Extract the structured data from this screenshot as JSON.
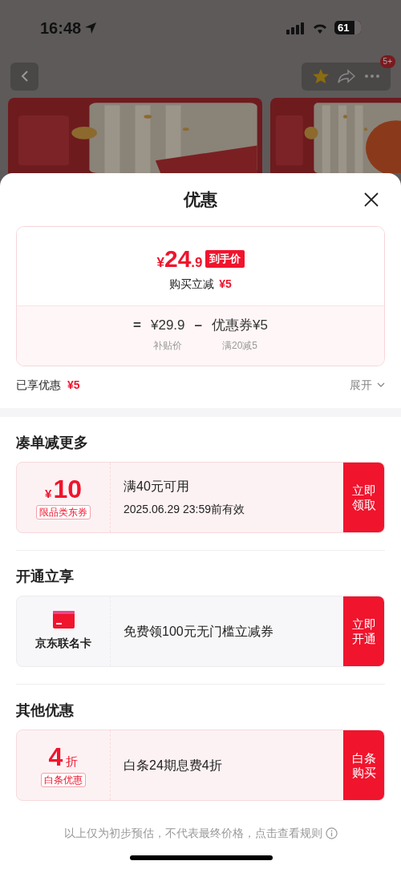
{
  "status_bar": {
    "time": "16:48",
    "battery": "61"
  },
  "nav": {
    "badge": "5+"
  },
  "sheet": {
    "title": "优惠"
  },
  "price_card": {
    "currency": "¥",
    "integer": "24",
    "decimal": ".9",
    "tag": "到手价",
    "instant_label": "购买立减",
    "instant_amount": "¥5",
    "equals": "=",
    "base": "¥29.9",
    "base_label": "补贴价",
    "minus": "–",
    "coupon": "优惠券¥5",
    "coupon_label": "满20减5"
  },
  "summary": {
    "label": "已享优惠",
    "amount": "¥5",
    "expand": "展开",
    "expanded": false
  },
  "sections": [
    {
      "title": "凑单减更多",
      "offers": [
        {
          "kind": "coupon",
          "currency": "¥",
          "value": "10",
          "tag": "限品类东券",
          "lines": [
            "满40元可用",
            "2025.06.29 23:59前有效"
          ],
          "button": [
            "立即",
            "领取"
          ]
        }
      ]
    },
    {
      "title": "开通立享",
      "offers": [
        {
          "kind": "card",
          "label": "京东联名卡",
          "lines": [
            "免费领100元无门槛立减券"
          ],
          "button": [
            "立即",
            "开通"
          ]
        }
      ]
    },
    {
      "title": "其他优惠",
      "offers": [
        {
          "kind": "discount",
          "value": "4",
          "unit": "折",
          "tag": "白条优惠",
          "lines": [
            "白条24期息费4折"
          ],
          "button": [
            "白条",
            "购买"
          ]
        }
      ]
    }
  ],
  "footer": {
    "text": "以上仅为初步预估，不代表最终价格，点击查看规则"
  }
}
